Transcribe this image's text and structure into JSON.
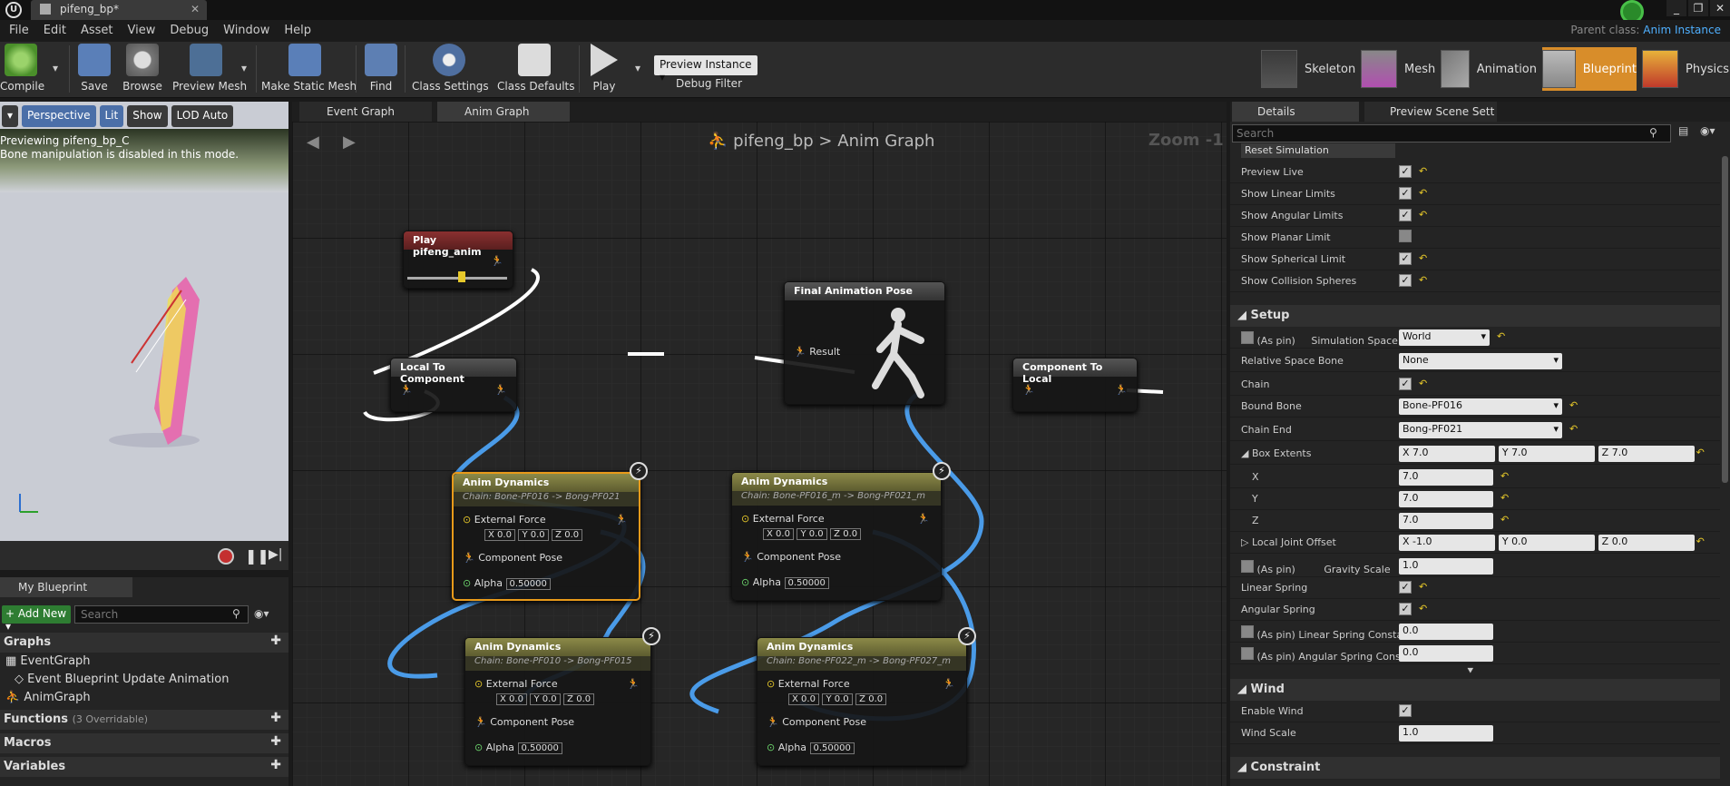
{
  "window": {
    "tab_title": "pifeng_bp*",
    "parent_class_label": "Parent class:",
    "parent_class_value": "Anim Instance"
  },
  "menu": [
    "File",
    "Edit",
    "Asset",
    "View",
    "Debug",
    "Window",
    "Help"
  ],
  "toolbar": {
    "compile": "Compile",
    "save": "Save",
    "browse": "Browse",
    "preview_mesh": "Preview Mesh",
    "make_static_mesh": "Make Static Mesh",
    "find": "Find",
    "class_settings": "Class Settings",
    "class_defaults": "Class Defaults",
    "play": "Play",
    "preview_instance": "Preview Instance",
    "debug_filter": "Debug Filter"
  },
  "modes": {
    "skeleton": "Skeleton",
    "mesh": "Mesh",
    "animation": "Animation",
    "blueprint": "Blueprint",
    "physics": "Physics"
  },
  "viewport": {
    "perspective": "Perspective",
    "lit": "Lit",
    "show": "Show",
    "lod": "LOD Auto",
    "line1": "Previewing pifeng_bp_C",
    "line2": "Bone manipulation is disabled in this mode."
  },
  "my_blueprint": {
    "tab": "My Blueprint",
    "add_new": "Add New",
    "search_placeholder": "Search",
    "graphs": "Graphs",
    "event_graph": "EventGraph",
    "event_update": "Event Blueprint Update Animation",
    "anim_graph": "AnimGraph",
    "functions": "Functions",
    "functions_count": "(3 Overridable)",
    "macros": "Macros",
    "variables": "Variables"
  },
  "graph": {
    "tabs": [
      "Event Graph",
      "Anim Graph"
    ],
    "breadcrumb_bp": "pifeng_bp",
    "breadcrumb_sep": ">",
    "breadcrumb_graph": "Anim Graph",
    "zoom": "Zoom -1",
    "play_node": "Play pifeng_anim",
    "local_to_component": "Local To Component",
    "final_pose": "Final Animation Pose",
    "result": "Result",
    "component_to_local": "Component To Local",
    "dyn_title": "Anim Dynamics",
    "dyn1_chain": "Chain: Bone-PF016 -> Bong-PF021",
    "dyn2_chain": "Chain: Bone-PF016_m -> Bong-PF021_m",
    "dyn3_chain": "Chain: Bone-PF010 -> Bong-PF015",
    "dyn4_chain": "Chain: Bone-PF022_m -> Bong-PF027_m",
    "external_force": "External Force",
    "component_pose": "Component Pose",
    "alpha": "Alpha",
    "alpha_val": "0.50000",
    "x": "X",
    "y": "Y",
    "z": "Z",
    "zero": "0.0"
  },
  "details": {
    "tab": "Details",
    "tab2": "Preview Scene Sett",
    "search_placeholder": "Search",
    "reset_simulation": "Reset Simulation",
    "preview_live": "Preview Live",
    "show_linear": "Show Linear Limits",
    "show_angular": "Show Angular Limits",
    "show_planar": "Show Planar Limit",
    "show_spherical": "Show Spherical Limit",
    "show_collision": "Show Collision Spheres",
    "setup": "Setup",
    "as_pin": "(As pin)",
    "simulation_space": "Simulation Space",
    "simulation_space_val": "World",
    "relative_space_bone": "Relative Space Bone",
    "relative_space_bone_val": "None",
    "chain": "Chain",
    "bound_bone": "Bound Bone",
    "bound_bone_val": "Bone-PF016",
    "chain_end": "Chain End",
    "chain_end_val": "Bong-PF021",
    "box_extents": "Box Extents",
    "box_x": "7.0",
    "box_y": "7.0",
    "box_z": "7.0",
    "local_joint_offset": "Local Joint Offset",
    "ljo_x": "-1.0",
    "ljo_y": "0.0",
    "ljo_z": "0.0",
    "gravity_scale": "Gravity Scale",
    "gravity_scale_val": "1.0",
    "linear_spring": "Linear Spring",
    "angular_spring": "Angular Spring",
    "linear_spring_constant": "(As pin) Linear Spring Constant",
    "linear_spring_constant_val": "0.0",
    "angular_spring_constant": "(As pin) Angular Spring Constar",
    "angular_spring_constant_val": "0.0",
    "wind": "Wind",
    "enable_wind": "Enable Wind",
    "wind_scale": "Wind Scale",
    "wind_scale_val": "1.0",
    "constraint": "Constraint",
    "x": "X",
    "y": "Y",
    "z": "Z"
  },
  "colors": {
    "accent": "#d88d2a",
    "link": "#4fb0ff",
    "wire_blue": "#4a9be8",
    "wire_white": "#ffffff",
    "add_new": "#2e7d32"
  }
}
